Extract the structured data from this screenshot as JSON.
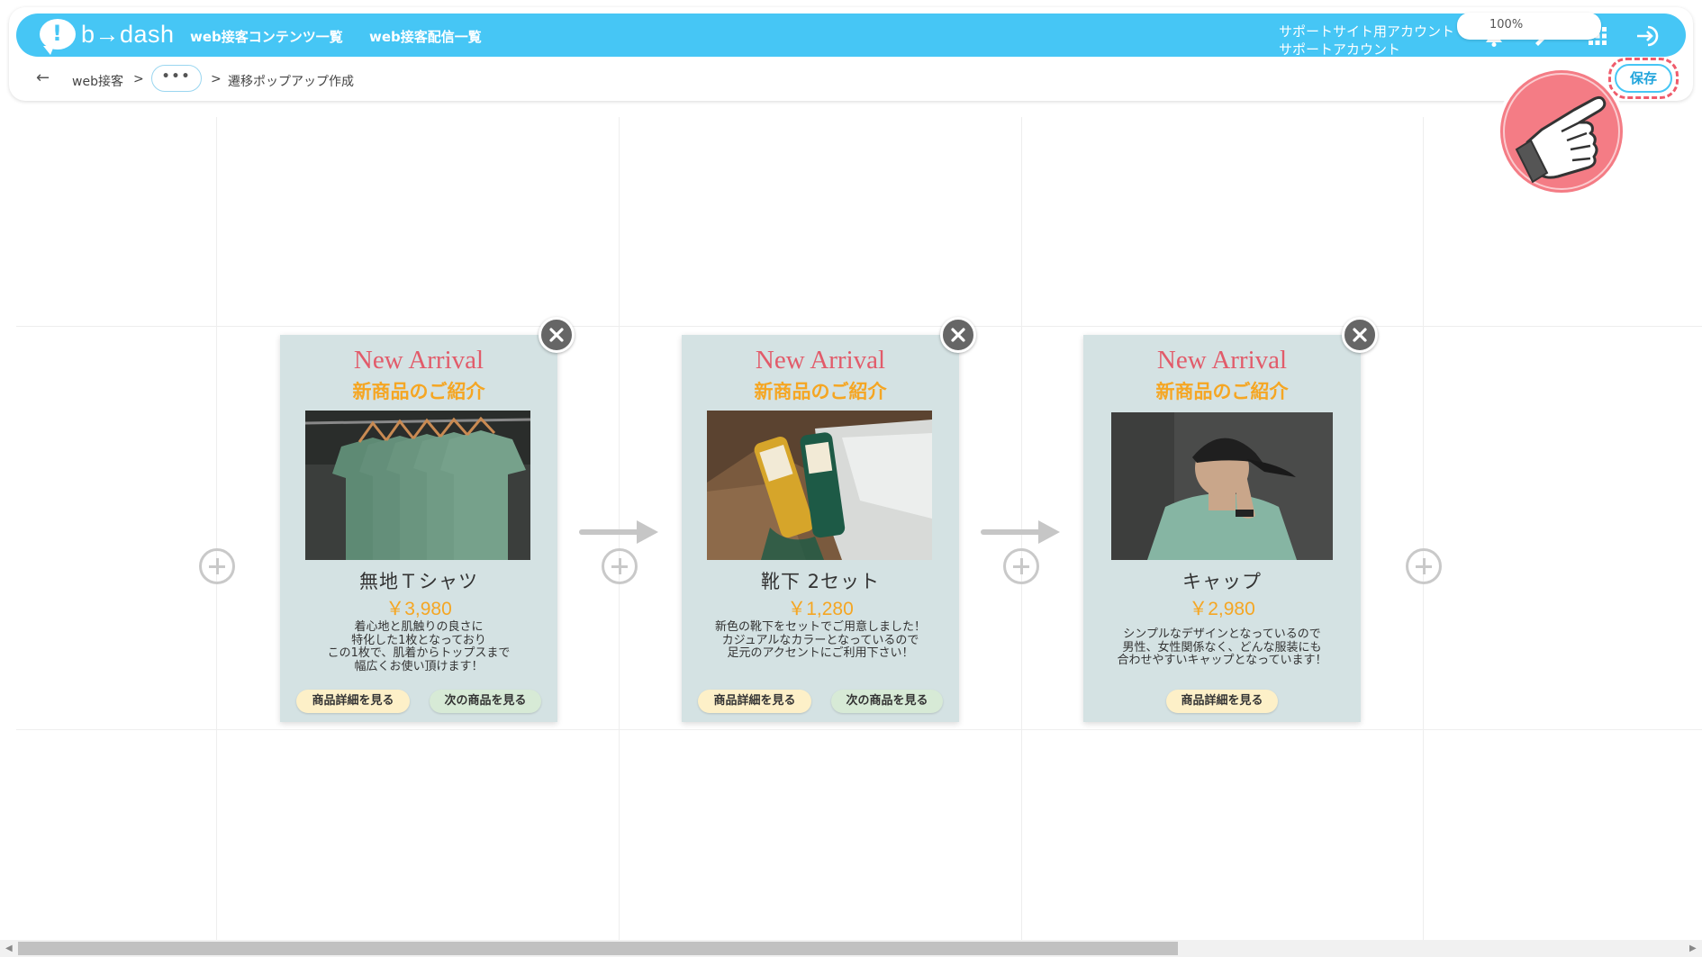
{
  "header": {
    "logo_text": "b→dash",
    "nav": [
      "web接客コンテンツ一覧",
      "web接客配信一覧"
    ],
    "account_line1": "サポートサイト用アカウント",
    "account_line2": "サポートアカウント",
    "icons": [
      "bell-icon",
      "wrench-icon",
      "grid-icon",
      "logout-icon"
    ]
  },
  "subbar": {
    "crumb_root": "web接客",
    "separator": ">",
    "ellipsis": "•••",
    "crumb_current": "遷移ポップアップ作成",
    "zoom": "100%",
    "save_label": "保存"
  },
  "cards": [
    {
      "title_en": "New Arrival",
      "title_ja": "新商品のご紹介",
      "name": "無地Ｔシャツ",
      "price": "￥3,980",
      "desc": "着心地と肌触りの良さに\n特化した1枚となっており\nこの1枚で、肌着からトップスまで\n幅広くお使い頂けます！",
      "detail_btn": "商品詳細を見る",
      "next_btn": "次の商品を見る"
    },
    {
      "title_en": "New Arrival",
      "title_ja": "新商品のご紹介",
      "name": "靴下 2セット",
      "price": "￥1,280",
      "desc": "新色の靴下をセットでご用意しました！\nカジュアルなカラーとなっているので\n足元のアクセントにご利用下さい！",
      "detail_btn": "商品詳細を見る",
      "next_btn": "次の商品を見る"
    },
    {
      "title_en": "New Arrival",
      "title_ja": "新商品のご紹介",
      "name": "キャップ",
      "price": "￥2,980",
      "desc": "シンプルなデザインとなっているので\n男性、女性関係なく、どんな服装にも\n合わせやすいキャップとなっています！",
      "detail_btn": "商品詳細を見る"
    }
  ]
}
